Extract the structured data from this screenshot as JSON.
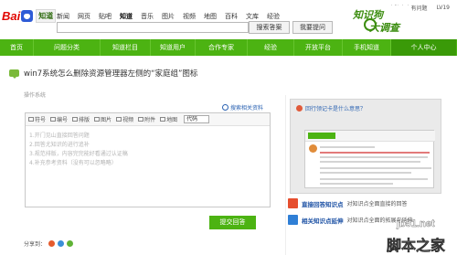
{
  "logo": {
    "brand_left": "Bai",
    "brand_right": "知道"
  },
  "topnav": [
    "新闻",
    "网页",
    "贴吧",
    "知道",
    "音乐",
    "图片",
    "视频",
    "地图",
    "百科",
    "文库",
    "经验"
  ],
  "topnav_active": "知道",
  "search": {
    "placeholder": "",
    "search_label": "搜索答案",
    "ask_label": "我要提问"
  },
  "user": {
    "name": "电脑人人有问题",
    "level": "LV19"
  },
  "banner": {
    "line1": "知识狗",
    "line2": "大调查"
  },
  "greennav": [
    "首页",
    "问题分类",
    "知道栏目",
    "知道用户",
    "合作专家",
    "经验",
    "开放平台",
    "手机知道",
    "个人中心"
  ],
  "question": {
    "title": "win7系统怎么删除资源管理器左侧的“家庭组”图标",
    "sub": "操作系统",
    "helper": "搜索相关资料"
  },
  "toolbar": {
    "items": [
      "符号",
      "编号",
      "排版",
      "图片",
      "视频",
      "附件",
      "地图"
    ],
    "code_label": "代码"
  },
  "hints": [
    "1.开门见山直接回答问题",
    "2.回答尤知识的进行追补",
    "3.规范排版，内容完完能好看通过认证稿",
    "4.补充参考资料（没有可以忽略略）"
  ],
  "submit_label": "提交回答",
  "share_label": "分享到：",
  "promo": {
    "head": "回行领记卡是什么意思？"
  },
  "links": [
    {
      "title": "直接回答知识点",
      "desc": "对知识点全面直接的回答"
    },
    {
      "title": "相关知识点延伸",
      "desc": "对知识点全面的拓展与延伸"
    }
  ],
  "watermark": {
    "line1": "jb51.net",
    "line2": "脚本之家"
  },
  "colors": {
    "accent": "#4cb312",
    "link": "#1a4fa3",
    "logo_red": "#e10601",
    "logo_blue": "#2e5bd6"
  }
}
